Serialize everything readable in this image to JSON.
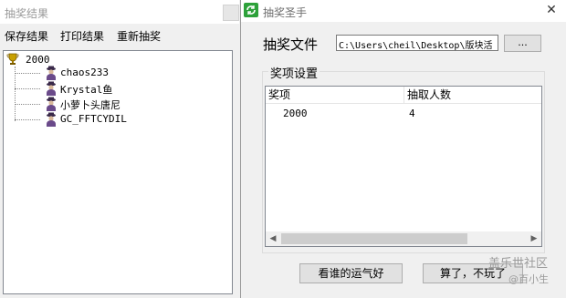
{
  "results_window": {
    "title": "抽奖结果",
    "menu": [
      "保存结果",
      "打印结果",
      "重新抽奖"
    ],
    "tree": {
      "root": "2000",
      "root_icon": "trophy-icon",
      "winners": [
        "chaos233",
        "Krystal鱼",
        "小萝卜头唐尼",
        "GC_FFTCYDIL"
      ],
      "winner_icon": "user-icon"
    }
  },
  "lottery_window": {
    "title": "抽奖圣手",
    "file_label": "抽奖文件",
    "file_path": "C:\\Users\\cheil\\Desktop\\版块活",
    "browse_label": "...",
    "group_title": "奖项设置",
    "columns": [
      "奖项",
      "抽取人数"
    ],
    "rows": [
      {
        "prize": "2000",
        "count": "4"
      }
    ],
    "draw_button": "看谁的运气好",
    "quit_button": "算了，不玩了"
  },
  "watermark": {
    "line1": "盖乐世社区",
    "line2": "@百小生"
  },
  "colors": {
    "app_icon_green": "#2da13a",
    "trophy_gold": "#b8860b"
  }
}
